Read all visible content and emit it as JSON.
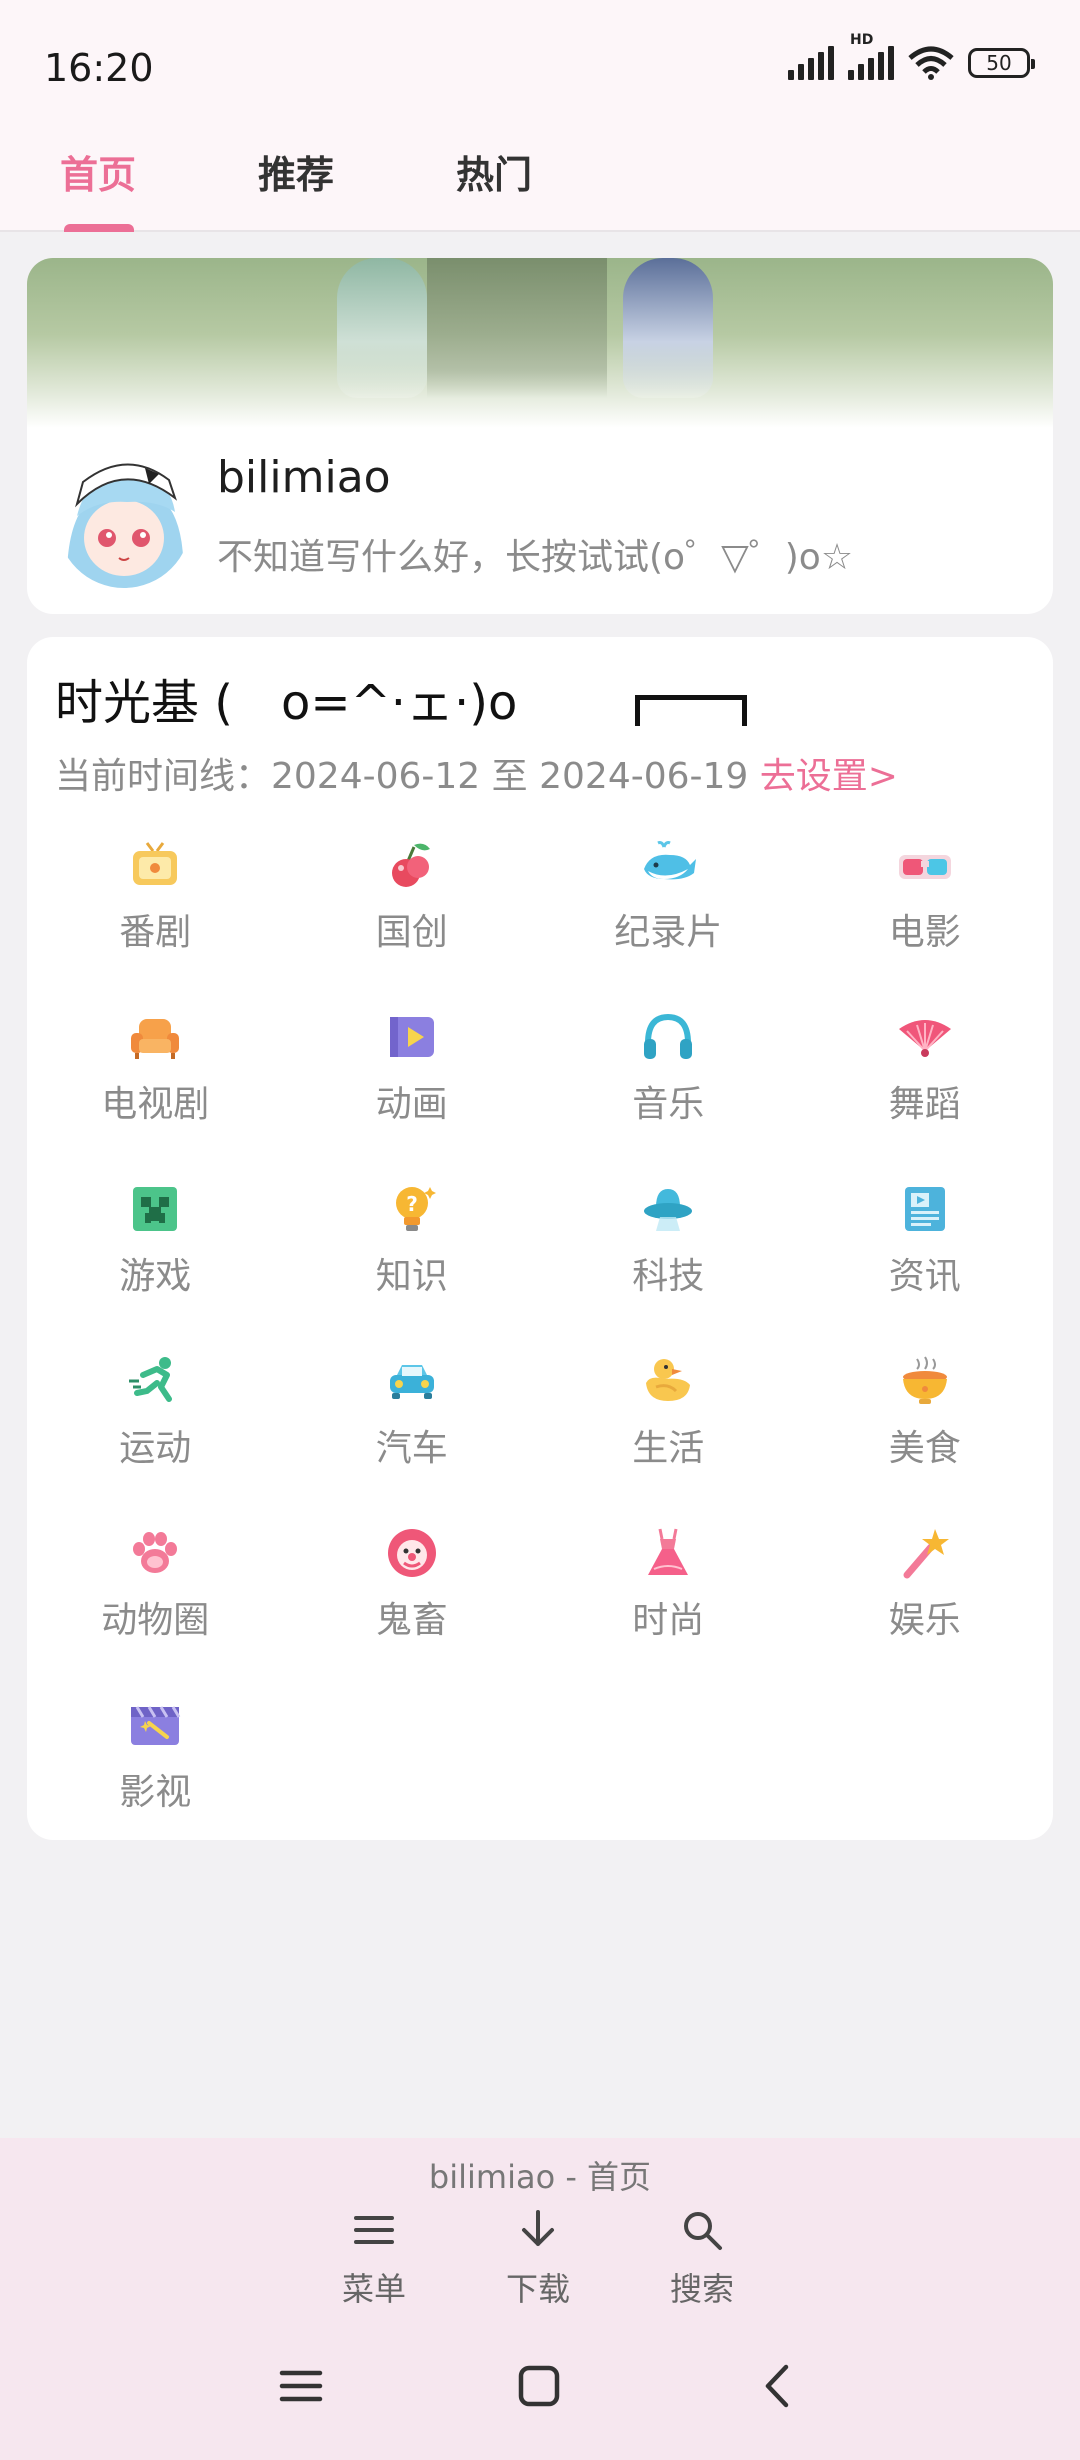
{
  "status": {
    "time": "16:20",
    "battery": "50",
    "network_badge": "HD"
  },
  "tabs": [
    {
      "label": "首页",
      "active": true
    },
    {
      "label": "推荐",
      "active": false
    },
    {
      "label": "热门",
      "active": false
    }
  ],
  "profile": {
    "username": "bilimiao",
    "bio": "不知道写什么好，长按试试(o゜▽゜)o☆"
  },
  "timeline": {
    "title": "时光基 (　o=^·ェ·)o",
    "range_text": "当前时间线：2024-06-12 至 2024-06-19 ",
    "settings_link": "去设置>",
    "categories": [
      {
        "label": "番剧",
        "icon": "tv-icon"
      },
      {
        "label": "国创",
        "icon": "cherry-icon"
      },
      {
        "label": "纪录片",
        "icon": "whale-icon"
      },
      {
        "label": "电影",
        "icon": "3d-glasses-icon"
      },
      {
        "label": "电视剧",
        "icon": "sofa-icon"
      },
      {
        "label": "动画",
        "icon": "play-icon"
      },
      {
        "label": "音乐",
        "icon": "headphones-icon"
      },
      {
        "label": "舞蹈",
        "icon": "fan-icon"
      },
      {
        "label": "游戏",
        "icon": "creeper-icon"
      },
      {
        "label": "知识",
        "icon": "lightbulb-icon"
      },
      {
        "label": "科技",
        "icon": "ufo-icon"
      },
      {
        "label": "资讯",
        "icon": "newspaper-icon"
      },
      {
        "label": "运动",
        "icon": "runner-icon"
      },
      {
        "label": "汽车",
        "icon": "car-icon"
      },
      {
        "label": "生活",
        "icon": "duck-icon"
      },
      {
        "label": "美食",
        "icon": "food-bowl-icon"
      },
      {
        "label": "动物圈",
        "icon": "paw-icon"
      },
      {
        "label": "鬼畜",
        "icon": "clown-icon"
      },
      {
        "label": "时尚",
        "icon": "dress-icon"
      },
      {
        "label": "娱乐",
        "icon": "magic-wand-icon"
      },
      {
        "label": "影视",
        "icon": "clapperboard-icon"
      }
    ]
  },
  "bottombar": {
    "title": "bilimiao - 首页",
    "menu_label": "菜单",
    "download_label": "下载",
    "search_label": "搜索"
  },
  "colors": {
    "accent": "#ec6f96",
    "page_bg": "#f2f1f3",
    "bottombar_bg": "#f6e7ef"
  }
}
